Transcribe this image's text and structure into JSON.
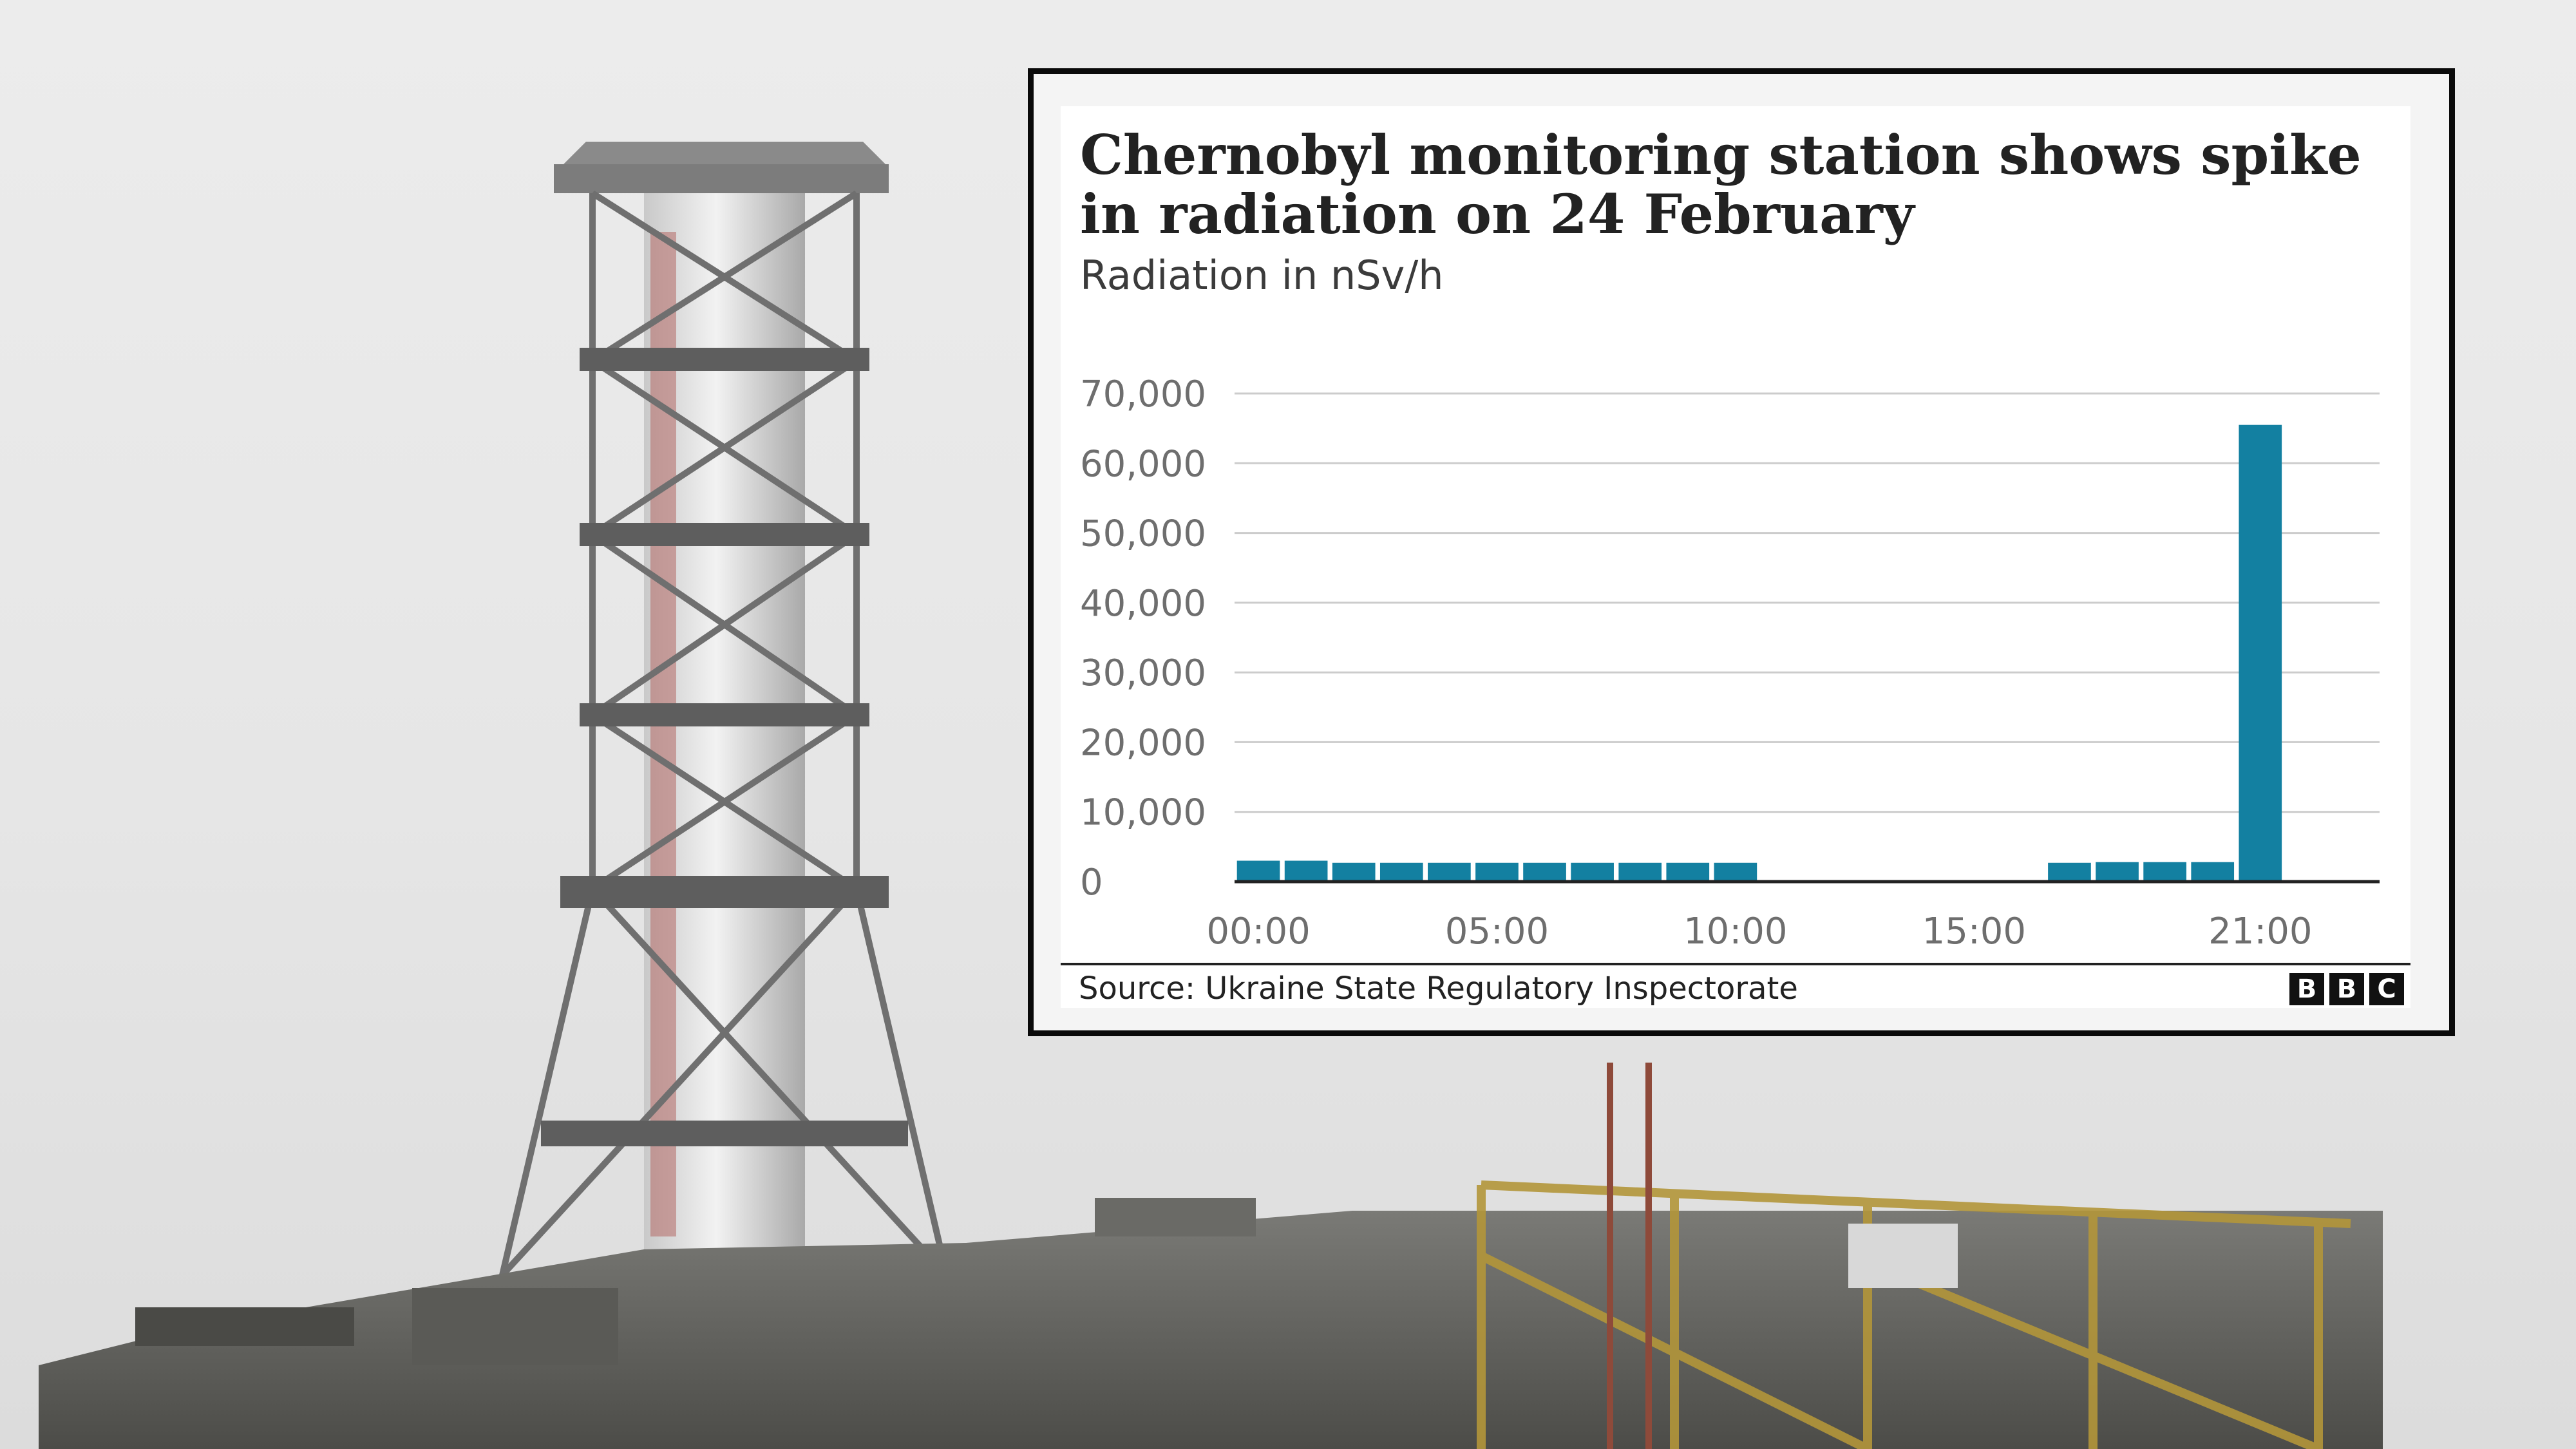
{
  "colors": {
    "bar": "#1380a1",
    "gridline": "#cccccc",
    "axis_line": "#222222",
    "card_border": "#0a0a0a"
  },
  "background_photo": {
    "scene": "chernobyl-chimney-and-reactor-structure"
  },
  "source": "Source: Ukraine State Regulatory Inspectorate",
  "logo": {
    "letters": [
      "B",
      "B",
      "C"
    ]
  },
  "chart_data": {
    "type": "bar",
    "title": "Chernobyl monitoring station shows spike in radiation on 24 February",
    "subtitle": "Radiation in nSv/h",
    "xlabel": "",
    "ylabel": "",
    "ylim": [
      0,
      70000
    ],
    "y_ticks": [
      0,
      10000,
      20000,
      30000,
      40000,
      50000,
      60000,
      70000
    ],
    "y_tick_labels": [
      "0",
      "10,000",
      "20,000",
      "30,000",
      "40,000",
      "50,000",
      "60,000",
      "70,000"
    ],
    "x_ticks": [
      {
        "hour": 0,
        "label": "00:00"
      },
      {
        "hour": 5,
        "label": "05:00"
      },
      {
        "hour": 10,
        "label": "10:00"
      },
      {
        "hour": 15,
        "label": "15:00"
      },
      {
        "hour": 21,
        "label": "21:00"
      }
    ],
    "x_range": [
      -0.5,
      23.5
    ],
    "grid": true,
    "legend": "none",
    "points": [
      {
        "hour": 0,
        "value": 3000
      },
      {
        "hour": 1,
        "value": 3000
      },
      {
        "hour": 2,
        "value": 2700
      },
      {
        "hour": 3,
        "value": 2700
      },
      {
        "hour": 4,
        "value": 2700
      },
      {
        "hour": 5,
        "value": 2700
      },
      {
        "hour": 6,
        "value": 2700
      },
      {
        "hour": 7,
        "value": 2700
      },
      {
        "hour": 8,
        "value": 2700
      },
      {
        "hour": 9,
        "value": 2700
      },
      {
        "hour": 10,
        "value": 2700
      },
      {
        "hour": 17,
        "value": 2700
      },
      {
        "hour": 18,
        "value": 2800
      },
      {
        "hour": 19,
        "value": 2800
      },
      {
        "hour": 20,
        "value": 2800
      },
      {
        "hour": 21,
        "value": 65500
      }
    ]
  }
}
